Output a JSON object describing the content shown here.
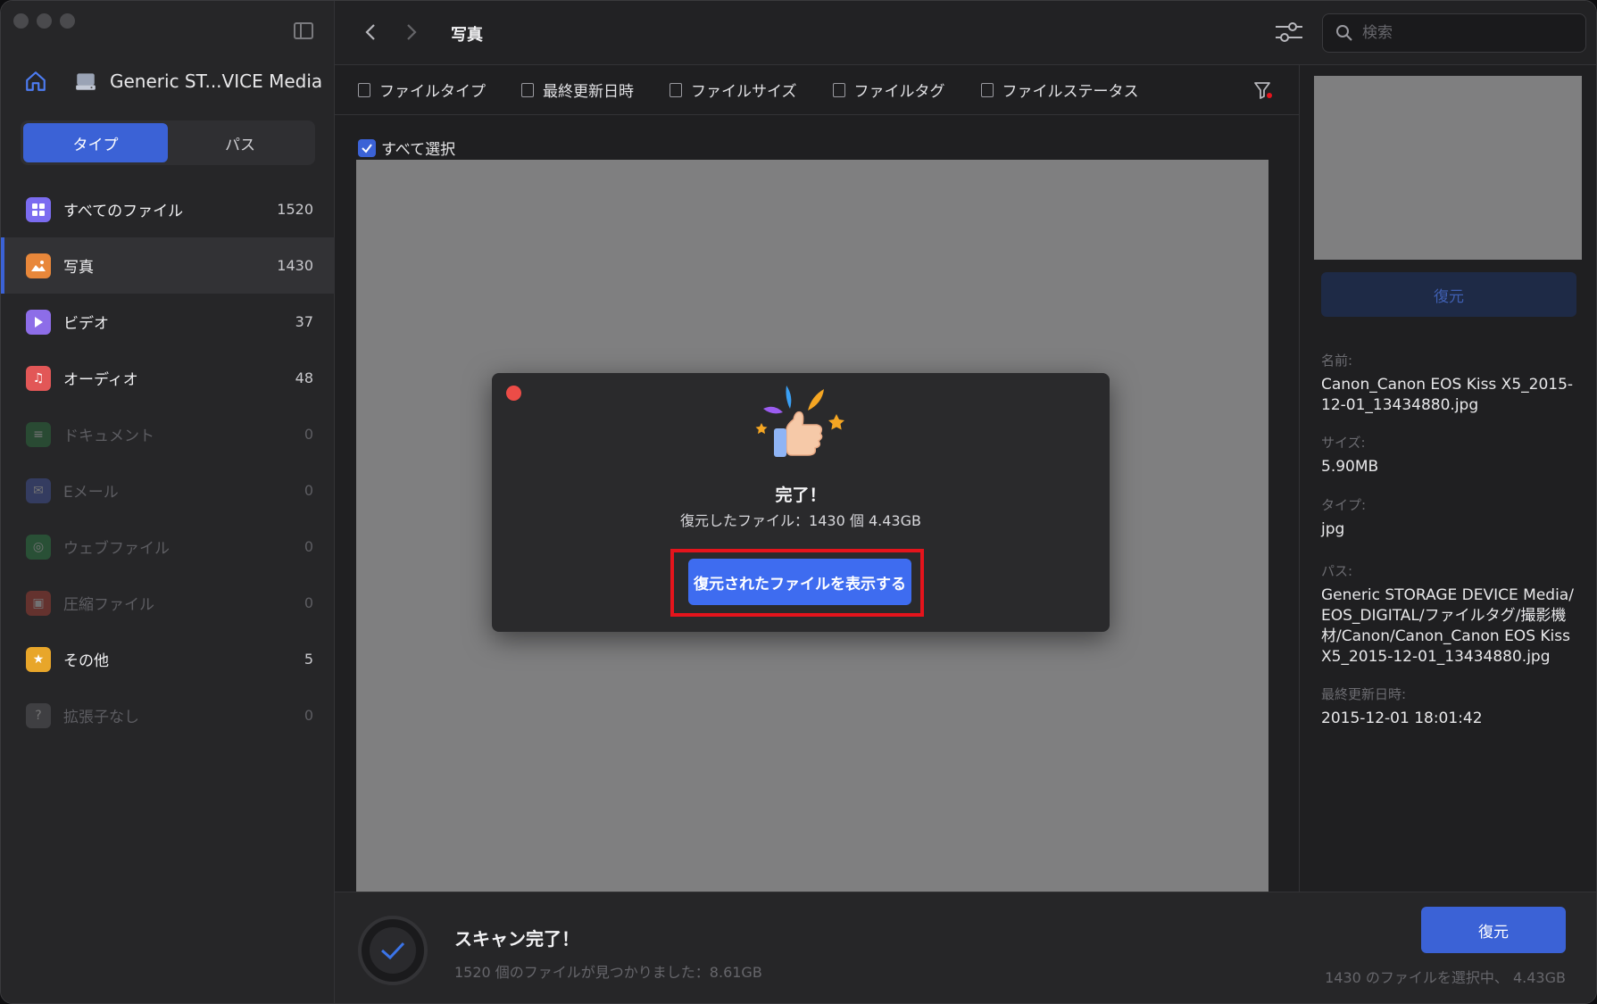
{
  "sidebar": {
    "device_name": "Generic ST...VICE Media",
    "tabs": [
      {
        "label": "タイプ",
        "active": true
      },
      {
        "label": "パス",
        "active": false
      }
    ],
    "categories": [
      {
        "label": "すべてのファイル",
        "count": "1520",
        "icon": "grid-icon",
        "color": "#7b6cf0"
      },
      {
        "label": "写真",
        "count": "1430",
        "icon": "photo-icon",
        "color": "#e8873a"
      },
      {
        "label": "ビデオ",
        "count": "37",
        "icon": "video-icon",
        "color": "#8d6de8"
      },
      {
        "label": "オーディオ",
        "count": "48",
        "icon": "audio-icon",
        "color": "#e25757"
      },
      {
        "label": "ドキュメント",
        "count": "0",
        "icon": "document-icon",
        "color": "#2f8f4a"
      },
      {
        "label": "Eメール",
        "count": "0",
        "icon": "email-icon",
        "color": "#4f66c9"
      },
      {
        "label": "ウェブファイル",
        "count": "0",
        "icon": "web-icon",
        "color": "#2f9f50"
      },
      {
        "label": "圧縮ファイル",
        "count": "0",
        "icon": "archive-icon",
        "color": "#d94a3a"
      },
      {
        "label": "その他",
        "count": "5",
        "icon": "star-icon",
        "color": "#e8a62a"
      },
      {
        "label": "拡張子なし",
        "count": "0",
        "icon": "unknown-icon",
        "color": "#6f6f74"
      }
    ]
  },
  "topbar": {
    "breadcrumb": "写真",
    "search_placeholder": "検索"
  },
  "filters": [
    "ファイルタイプ",
    "最終更新日時",
    "ファイルサイズ",
    "ファイルタグ",
    "ファイルステータス"
  ],
  "main": {
    "select_all": "すべて選択"
  },
  "modal": {
    "title": "完了！",
    "subtitle": "復元したファイル：1430 個 4.43GB",
    "button": "復元されたファイルを表示する"
  },
  "detail": {
    "restore_button": "復元",
    "fields": [
      {
        "key": "名前:",
        "value": "Canon_Canon EOS Kiss X5_2015-12-01_13434880.jpg"
      },
      {
        "key": "サイズ:",
        "value": "5.90MB"
      },
      {
        "key": "タイプ:",
        "value": "jpg"
      },
      {
        "key": "パス:",
        "value": "Generic STORAGE DEVICE Media/EOS_DIGITAL/ファイルタグ/撮影機材/Canon/Canon_Canon EOS Kiss X5_2015-12-01_13434880.jpg"
      },
      {
        "key": "最終更新日時:",
        "value": "2015-12-01 18:01:42"
      }
    ]
  },
  "bottombar": {
    "scan_title": "スキャン完了！",
    "scan_sub": "1520 個のファイルが見つかりました：8.61GB",
    "restore_button": "復元",
    "selection_info": "1430 のファイルを選択中、 4.43GB"
  }
}
